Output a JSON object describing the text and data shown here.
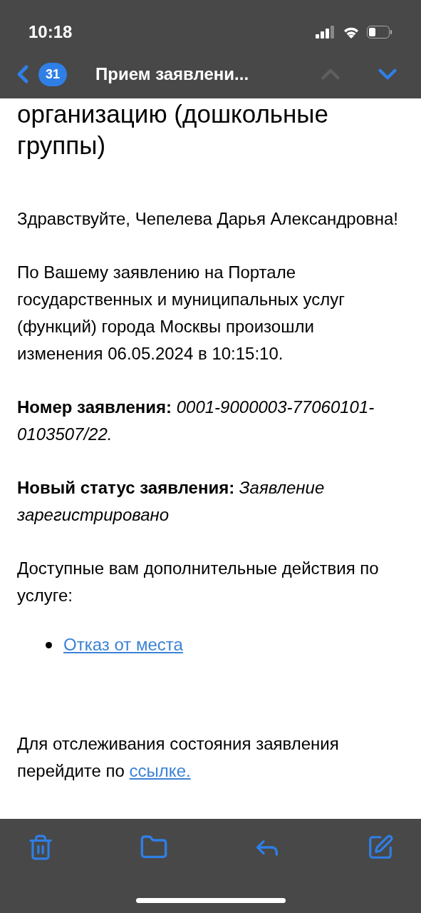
{
  "status_bar": {
    "time": "10:18"
  },
  "nav": {
    "badge": "31",
    "title": "Прием заявлени...",
    "previous_disabled": true,
    "next_disabled": false
  },
  "email": {
    "heading": "организацию (дошкольные группы)",
    "blocks": [
      {
        "kind": "text",
        "text": "Здравствуйте, Чепелева Дарья Александровна!"
      },
      {
        "kind": "text",
        "text": "По Вашему заявлению на Портале государственных и муниципальных услуг (функций) города Москвы произошли изменения 06.05.2024 в 10:15:10."
      },
      {
        "kind": "text",
        "text": "**Номер заявления:** *0001-9000003-77060101-0103507/22.*"
      },
      {
        "kind": "text",
        "text": "**Новый статус заявления:** *Заявление зарегистрировано*"
      },
      {
        "kind": "text",
        "text": "Доступные вам дополнительные действия по услуге:"
      },
      {
        "kind": "links_list",
        "items": [
          "Отказ от места"
        ]
      },
      {
        "kind": "text_with_link",
        "text": "Для отслеживания состояния заявления перейдите по",
        "link": "ссылке."
      }
    ]
  }
}
